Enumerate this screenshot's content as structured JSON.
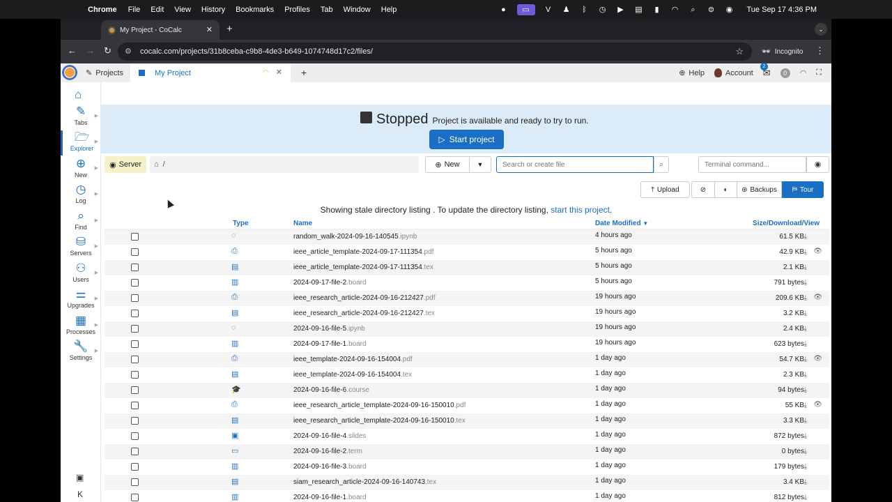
{
  "menubar": {
    "app": "Chrome",
    "items": [
      "File",
      "Edit",
      "View",
      "History",
      "Bookmarks",
      "Profiles",
      "Tab",
      "Window",
      "Help"
    ],
    "clock": "Tue Sep 17  4:36 PM"
  },
  "browser": {
    "tab_title": "My Project - CoCalc",
    "url": "cocalc.com/projects/31b8ceba-c9b8-4de3-b649-1074748d17c2/files/",
    "incognito_label": "Incognito"
  },
  "cocalc": {
    "projects_label": "Projects",
    "project_tab_label": "My Project",
    "help_label": "Help",
    "account_label": "Account",
    "message_count": "2",
    "notification_count": "0"
  },
  "sidebar": {
    "items": [
      {
        "label": "Tabs",
        "icon": "pencil-icon"
      },
      {
        "label": "Explorer",
        "icon": "folder-open-icon"
      },
      {
        "label": "New",
        "icon": "plus-circle-icon"
      },
      {
        "label": "Log",
        "icon": "history-icon"
      },
      {
        "label": "Find",
        "icon": "search-icon"
      },
      {
        "label": "Servers",
        "icon": "server-icon"
      },
      {
        "label": "Users",
        "icon": "users-icon"
      },
      {
        "label": "Upgrades",
        "icon": "sliders-icon"
      },
      {
        "label": "Processes",
        "icon": "processes-icon"
      },
      {
        "label": "Settings",
        "icon": "wrench-icon"
      }
    ]
  },
  "banner": {
    "state": "Stopped",
    "description": "Project is available and ready to try to run.",
    "start_label": "Start project"
  },
  "actions": {
    "server_label": "Server",
    "path": "/",
    "new_label": "New",
    "search_placeholder": "Search or create file",
    "terminal_placeholder": "Terminal command...",
    "upload_label": "Upload",
    "backups_label": "Backups",
    "tour_label": "Tour"
  },
  "stale": {
    "text": "Showing stale directory listing . To update the directory listing,",
    "link": "start this project",
    "end": "."
  },
  "listing": {
    "headers": {
      "type": "Type",
      "name": "Name",
      "date": "Date Modified",
      "size": "Size/Download/View"
    },
    "rows": [
      {
        "name": "random_walk-2024-09-16-140545",
        "ext": ".ipynb",
        "date": "4 hours ago",
        "size": "61.5 KB",
        "icon": "jupyter-icon",
        "view": false
      },
      {
        "name": "ieee_article_template-2024-09-17-111354",
        "ext": ".pdf",
        "date": "5 hours ago",
        "size": "42.9 KB",
        "icon": "pdf-icon",
        "view": true
      },
      {
        "name": "ieee_article_template-2024-09-17-111354",
        "ext": ".tex",
        "date": "5 hours ago",
        "size": "2.1 KB",
        "icon": "tex-icon",
        "view": false
      },
      {
        "name": "2024-09-17-file-2",
        "ext": ".board",
        "date": "5 hours ago",
        "size": "791 bytes",
        "icon": "board-icon",
        "view": false
      },
      {
        "name": "ieee_research_article-2024-09-16-212427",
        "ext": ".pdf",
        "date": "19 hours ago",
        "size": "209.6 KB",
        "icon": "pdf-icon",
        "view": true
      },
      {
        "name": "ieee_research_article-2024-09-16-212427",
        "ext": ".tex",
        "date": "19 hours ago",
        "size": "3.2 KB",
        "icon": "tex-icon",
        "view": false
      },
      {
        "name": "2024-09-16-file-5",
        "ext": ".ipynb",
        "date": "19 hours ago",
        "size": "2.4 KB",
        "icon": "jupyter-icon",
        "view": false
      },
      {
        "name": "2024-09-17-file-1",
        "ext": ".board",
        "date": "19 hours ago",
        "size": "623 bytes",
        "icon": "board-icon",
        "view": false
      },
      {
        "name": "ieee_template-2024-09-16-154004",
        "ext": ".pdf",
        "date": "1 day ago",
        "size": "54.7 KB",
        "icon": "pdf-icon",
        "view": true
      },
      {
        "name": "ieee_template-2024-09-16-154004",
        "ext": ".tex",
        "date": "1 day ago",
        "size": "2.3 KB",
        "icon": "tex-icon",
        "view": false
      },
      {
        "name": "2024-09-16-file-6",
        "ext": ".course",
        "date": "1 day ago",
        "size": "94 bytes",
        "icon": "graduation-cap-icon",
        "view": false
      },
      {
        "name": "ieee_research_article_template-2024-09-16-150010",
        "ext": ".pdf",
        "date": "1 day ago",
        "size": "55 KB",
        "icon": "pdf-icon",
        "view": true
      },
      {
        "name": "ieee_research_article_template-2024-09-16-150010",
        "ext": ".tex",
        "date": "1 day ago",
        "size": "3.3 KB",
        "icon": "tex-icon",
        "view": false
      },
      {
        "name": "2024-09-16-file-4",
        "ext": ".slides",
        "date": "1 day ago",
        "size": "872 bytes",
        "icon": "slides-icon",
        "view": false
      },
      {
        "name": "2024-09-16-file-2",
        "ext": ".term",
        "date": "1 day ago",
        "size": "0 bytes",
        "icon": "terminal-icon",
        "view": false
      },
      {
        "name": "2024-09-16-file-3",
        "ext": ".board",
        "date": "1 day ago",
        "size": "179 bytes",
        "icon": "board-icon",
        "view": false
      },
      {
        "name": "siam_research_article-2024-09-16-140743",
        "ext": ".tex",
        "date": "1 day ago",
        "size": "3.4 KB",
        "icon": "tex-icon",
        "view": false
      },
      {
        "name": "2024-09-16-file-1",
        "ext": ".board",
        "date": "1 day ago",
        "size": "812 bytes",
        "icon": "board-icon",
        "view": false
      }
    ]
  },
  "colors": {
    "accent": "#1b6fc2",
    "banner": "#dcebf8"
  }
}
